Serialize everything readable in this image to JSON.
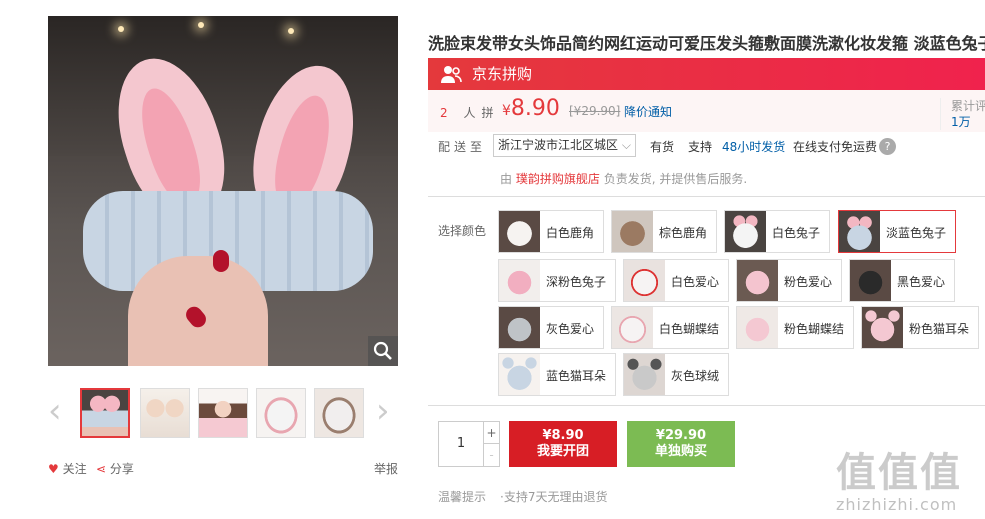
{
  "product": {
    "title": "洗脸束发带女头饰品简约网红运动可爱压发头箍敷面膜洗漱化妆发箍 淡蓝色兔子"
  },
  "gallery": {
    "zoom_icon": "magnifier-icon",
    "thumb_count": 5
  },
  "meta": {
    "favorite_label": "关注",
    "share_label": "分享",
    "report_label": "举报"
  },
  "pin": {
    "banner_text": "京东拼购",
    "group_size": "2",
    "group_suffix": "人拼",
    "currency": "¥",
    "price": "8.90",
    "original_price": "[¥29.90]",
    "price_notice": "降价通知",
    "review_label": "累计评",
    "review_count": "1万"
  },
  "delivery": {
    "label": "配送至",
    "address": "浙江宁波市江北区城区",
    "stock": "有货",
    "support": "支持",
    "fast": "48小时发货",
    "pay": "在线支付免运费",
    "help_icon": "?"
  },
  "seller": {
    "prefix": "由",
    "shop": "璞韵拼购旗舰店",
    "suffix": "负责发货, 并提供售后服务."
  },
  "colors": {
    "label": "选择颜色",
    "options": [
      "白色鹿角",
      "棕色鹿角",
      "白色兔子",
      "淡蓝色兔子",
      "深粉色兔子",
      "白色爱心",
      "粉色爱心",
      "黑色爱心",
      "灰色爱心",
      "白色蝴蝶结",
      "粉色蝴蝶结",
      "粉色猫耳朵",
      "蓝色猫耳朵",
      "灰色球绒"
    ],
    "selected": "淡蓝色兔子"
  },
  "purchase": {
    "quantity": "1",
    "plus": "+",
    "minus": "-",
    "group_price": "¥8.90",
    "group_label": "我要开团",
    "solo_price": "¥29.90",
    "solo_label": "单独购买"
  },
  "tips": {
    "label": "温馨提示",
    "text": "·支持7天无理由退货"
  },
  "watermark": {
    "big": "值值值",
    "small": "zhizhizhi.com"
  },
  "theme": {
    "accent": "#e4393c",
    "link": "#005ea7",
    "solo_green": "#7cbb53"
  }
}
